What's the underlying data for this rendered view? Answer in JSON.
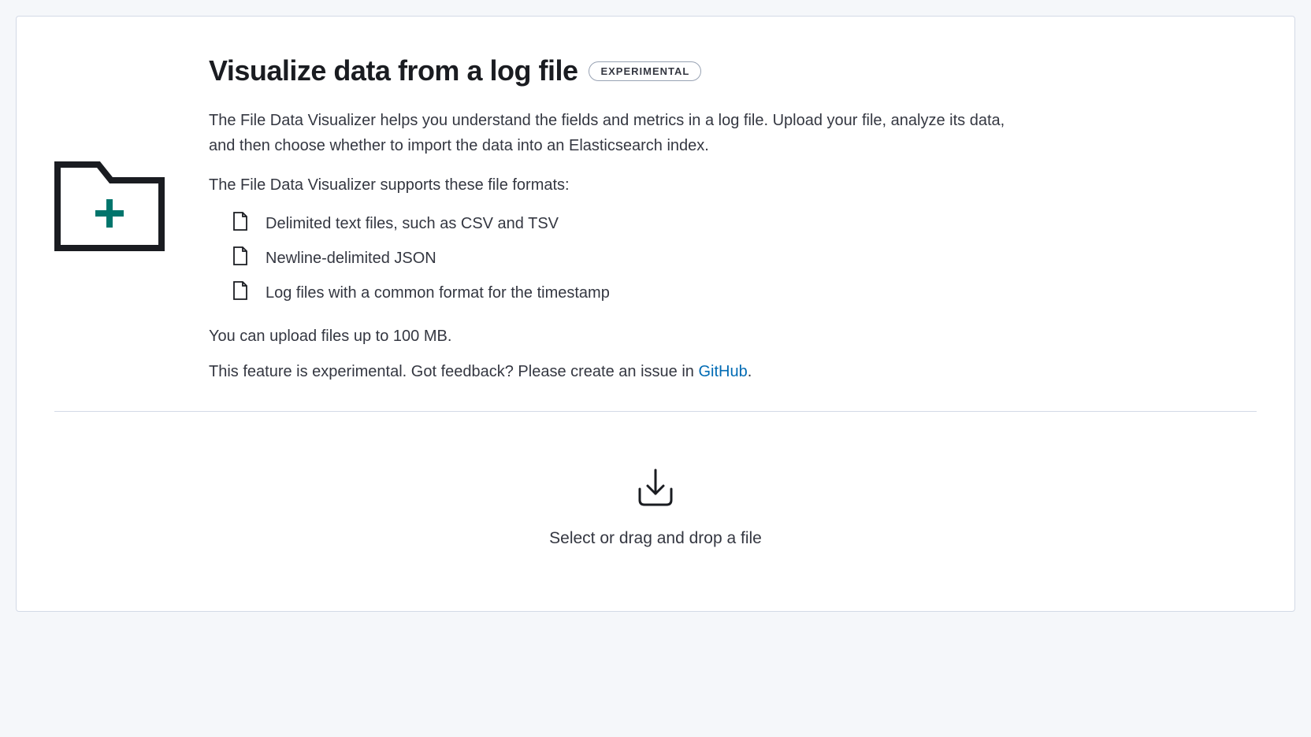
{
  "header": {
    "title": "Visualize data from a log file",
    "badge": "EXPERIMENTAL"
  },
  "description": "The File Data Visualizer helps you understand the fields and metrics in a log file. Upload your file, analyze its data, and then choose whether to import the data into an Elasticsearch index.",
  "formats_intro": "The File Data Visualizer supports these file formats:",
  "formats": [
    "Delimited text files, such as CSV and TSV",
    "Newline-delimited JSON",
    "Log files with a common format for the timestamp"
  ],
  "upload_limit": "You can upload files up to 100 MB.",
  "feedback_prefix": "This feature is experimental. Got feedback? Please create an issue in ",
  "feedback_link_text": "GitHub",
  "feedback_suffix": ".",
  "dropzone": {
    "label": "Select or drag and drop a file"
  }
}
